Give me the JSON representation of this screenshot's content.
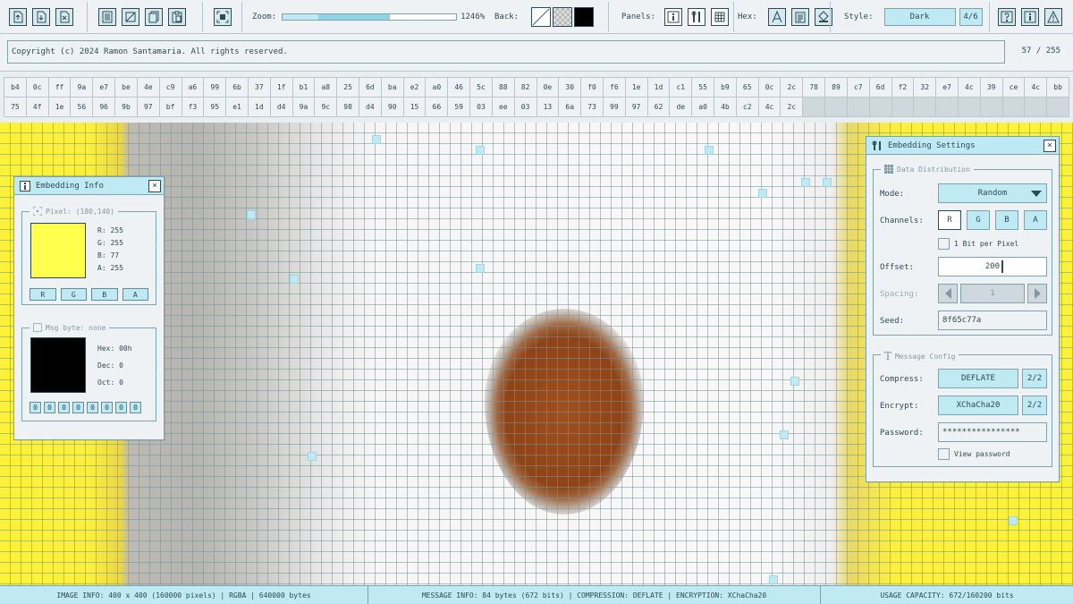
{
  "toolbar": {
    "zoom_label": "Zoom:",
    "zoom_value": "1246%",
    "zoom_fraction": 0.62,
    "back_label": "Back:",
    "panels_label": "Panels:",
    "hex_label": "Hex:",
    "style_label": "Style:",
    "style_value": "Dark",
    "style_count": "4/6",
    "icons": [
      "upload-icon",
      "download-icon",
      "file-x-icon",
      "document-icon",
      "crop-icon",
      "copy-icon",
      "paste-icon",
      "fit-screen-icon"
    ]
  },
  "copyright": {
    "text": "Copyright (c) 2024 Ramon Santamaria. All rights reserved.",
    "count": "57 / 255"
  },
  "hex": {
    "cells": [
      "b4",
      "0c",
      "ff",
      "9a",
      "e7",
      "be",
      "4e",
      "c9",
      "a6",
      "99",
      "6b",
      "37",
      "1f",
      "b1",
      "a8",
      "25",
      "6d",
      "ba",
      "e2",
      "a0",
      "46",
      "5c",
      "88",
      "82",
      "0e",
      "30",
      "f0",
      "f6",
      "1e",
      "1d",
      "c1",
      "55",
      "b9",
      "65",
      "0c",
      "2c",
      "78",
      "89",
      "c7",
      "6d",
      "f2",
      "32",
      "e7",
      "4c",
      "39",
      "ce",
      "4c",
      "bb",
      "75",
      "4f",
      "1e",
      "56",
      "96",
      "9b",
      "97",
      "bf",
      "f3",
      "95",
      "e1",
      "1d",
      "d4",
      "9a",
      "9c",
      "98",
      "d4",
      "90",
      "15",
      "66",
      "59",
      "03",
      "ee",
      "03",
      "13",
      "6a",
      "73",
      "99",
      "97",
      "62",
      "de",
      "a0",
      "4b",
      "c2",
      "4c",
      "2c"
    ],
    "total_cells": 96
  },
  "info_panel": {
    "title": "Embedding Info",
    "pixel_label": "Pixel: (180,140)",
    "pixel_color": "#ffff4d",
    "r": "R: 255",
    "g": "G: 255",
    "b": "B: 77",
    "a": "A: 255",
    "channels": [
      "R",
      "G",
      "B",
      "A"
    ],
    "msg_label": "Msg byte: none",
    "msg_color": "#000000",
    "hex": "Hex: 00h",
    "dec": "Dec: 0",
    "oct": "Oct: 0",
    "bits": [
      "0",
      "0",
      "0",
      "0",
      "0",
      "0",
      "0",
      "0"
    ]
  },
  "settings_panel": {
    "title": "Embedding Settings",
    "dist_title": "Data Distribution",
    "mode_label": "Mode:",
    "mode_value": "Random",
    "channels_label": "Channels:",
    "channels": [
      "R",
      "G",
      "B",
      "A"
    ],
    "bit_label": "1 Bit per Pixel",
    "offset_label": "Offset:",
    "offset_value": "200",
    "spacing_label": "Spacing:",
    "spacing_value": "1",
    "seed_label": "Seed:",
    "seed_value": "8f65c77a",
    "msg_title": "Message Config",
    "compress_label": "Compress:",
    "compress_value": "DEFLATE",
    "compress_count": "2/2",
    "encrypt_label": "Encrypt:",
    "encrypt_value": "XChaCha20",
    "encrypt_count": "2/2",
    "password_label": "Password:",
    "password_value": "****************",
    "view_label": "View password"
  },
  "status": {
    "image_info": "IMAGE INFO: 400 x 400 (160000 pixels) | RGBA | 640000 bytes",
    "message_info": "MESSAGE INFO: 84 bytes (672 bits) | COMPRESSION: DEFLATE | ENCRYPTION: XChaCha20",
    "capacity": "USAGE CAPACITY: 672/160200 bits"
  },
  "colors": {
    "accent": "#bfe9f3",
    "border": "#7fa3ae",
    "text": "#2e4a55",
    "panel_bg": "#eef2f4"
  }
}
